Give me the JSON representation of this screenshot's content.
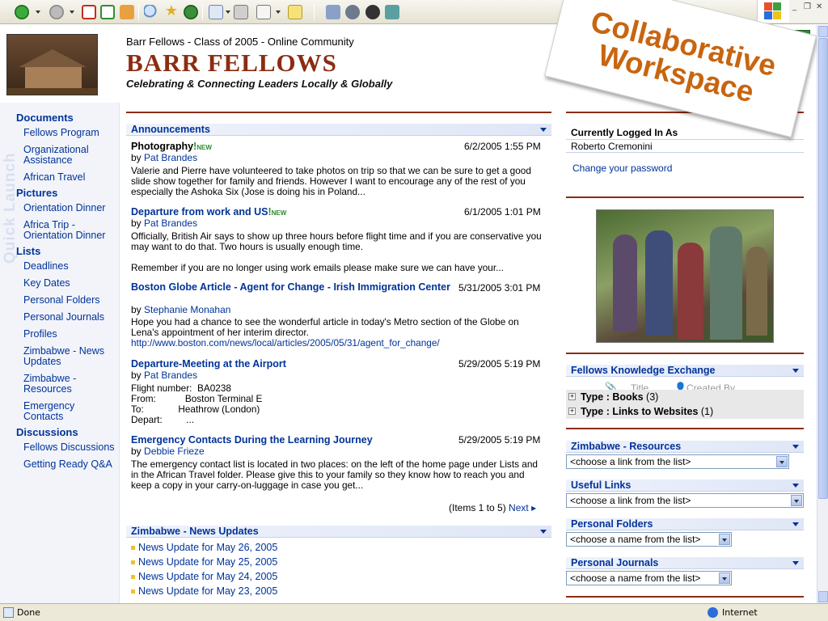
{
  "window": {
    "status_text": "Done",
    "zone": "Internet"
  },
  "header": {
    "subtitle": "Barr Fellows - Class of 2005 - Online Community",
    "title": "BARR FELLOWS",
    "tagline": "Celebrating & Connecting Leaders Locally & Globally",
    "stamp_line1": "Collaborative",
    "stamp_line2": "Workspace"
  },
  "quick_launch": {
    "label": "Quick Launch",
    "sections": [
      {
        "heading": "Documents",
        "items": [
          "Fellows Program",
          "Organizational Assistance",
          "African Travel"
        ]
      },
      {
        "heading": "Pictures",
        "items": [
          "Orientation Dinner",
          "Africa Trip - Orientation Dinner"
        ]
      },
      {
        "heading": "Lists",
        "items": [
          "Deadlines",
          "Key Dates",
          "Personal Folders",
          "Personal Journals",
          "Profiles",
          "Zimbabwe - News Updates",
          "Zimbabwe - Resources",
          "Emergency Contacts"
        ]
      },
      {
        "heading": "Discussions",
        "items": [
          "Fellows Discussions",
          "Getting Ready Q&A"
        ]
      }
    ]
  },
  "announcements": {
    "title": "Announcements",
    "items": [
      {
        "title": "Photography",
        "new": "NEW",
        "date": "6/2/2005 1:55 PM",
        "by": "by",
        "author": "Pat Brandes",
        "body": "Valerie and Pierre have volunteered to take photos on trip so that we can be sure to get a good slide show together for family and friends.  However I want to encourage any of the rest of you especially the Ashoka Six (Jose is doing his in Poland..."
      },
      {
        "title": "Departure from work and US",
        "new": "NEW",
        "date": "6/1/2005 1:01 PM",
        "by": "by",
        "author": "Pat Brandes",
        "body": "Officially, British Air says to show up three hours before flight time and if you are conservative you may want to do that.  Two hours is usually enough time.",
        "body2": "Remember if you are no longer using work emails please make sure we can have your..."
      },
      {
        "title": "Boston Globe Article - Agent for Change - Irish Immigration Center",
        "date": "5/31/2005 3:01 PM",
        "by": "by",
        "author": "Stephanie Monahan",
        "body": "Hope you had a chance to see the wonderful article in today's Metro section of the Globe on Lena's appointment of her interim director.",
        "link": "http://www.boston.com/news/local/articles/2005/05/31/agent_for_change/"
      },
      {
        "title": "Departure-Meeting at the Airport",
        "date": "5/29/2005 5:19 PM",
        "by": "by",
        "author": "Pat Brandes",
        "flight": [
          "Flight number:  BA0238",
          "From:           Boston Terminal E",
          "To:             Heathrow (London)",
          "Depart:         ..."
        ]
      },
      {
        "title": "Emergency Contacts During the Learning Journey",
        "date": "5/29/2005 5:19 PM",
        "by": "by",
        "author": "Debbie Frieze",
        "body": "The emergency contact list is located in two places: on the left of the home page under Lists and in the African Travel folder. Please give this to your family so they know how to reach you and keep a copy in your carry-on-luggage in case you get..."
      }
    ],
    "pager_text": "(Items 1 to 5)",
    "pager_next": "Next"
  },
  "news_updates": {
    "title": "Zimbabwe - News Updates",
    "items": [
      "News Update for May 26, 2005",
      "News Update for May 25, 2005",
      "News Update for May 24, 2005",
      "News Update for May 23, 2005"
    ]
  },
  "login": {
    "heading": "Currently Logged In As",
    "user": "Roberto Cremonini",
    "change_password": "Change your password"
  },
  "knowledge": {
    "title": "Fellows Knowledge Exchange",
    "col_title": "Title",
    "col_created": "Created By",
    "rows": [
      {
        "label": "Type : Books",
        "count": "(3)"
      },
      {
        "label": "Type : Links to Websites",
        "count": "(1)"
      }
    ]
  },
  "resources": {
    "title": "Zimbabwe - Resources",
    "value": "<choose a link from the list>"
  },
  "useful_links": {
    "title": "Useful Links",
    "value": "<choose a link from the list>"
  },
  "personal_folders": {
    "title": "Personal Folders",
    "value": "<choose a name from the list>"
  },
  "personal_journals": {
    "title": "Personal Journals",
    "value": "<choose a name from the list>"
  }
}
